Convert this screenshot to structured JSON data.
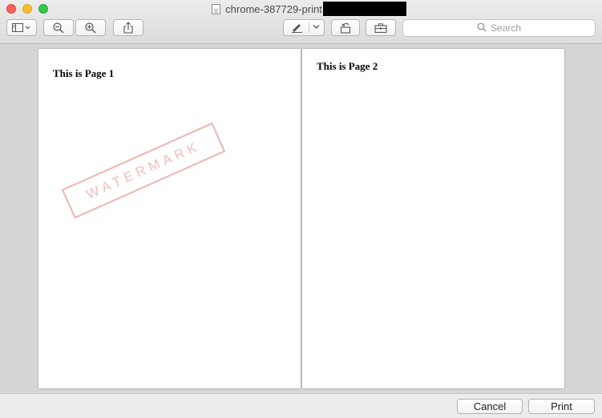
{
  "window": {
    "title": "chrome-387729-print"
  },
  "toolbar": {
    "sidebar_icon": "sidebar-icon",
    "zoom_out_icon": "zoom-out-icon",
    "zoom_in_icon": "zoom-in-icon",
    "share_icon": "share-icon",
    "markup_icon": "pen-icon",
    "rotate_icon": "rotate-icon",
    "toolbox_icon": "toolbox-icon",
    "search_placeholder": "Search"
  },
  "pages": [
    {
      "heading": "This is Page 1",
      "watermark": "WATERMARK"
    },
    {
      "heading": "This is Page 2"
    }
  ],
  "footer": {
    "cancel_label": "Cancel",
    "print_label": "Print"
  }
}
